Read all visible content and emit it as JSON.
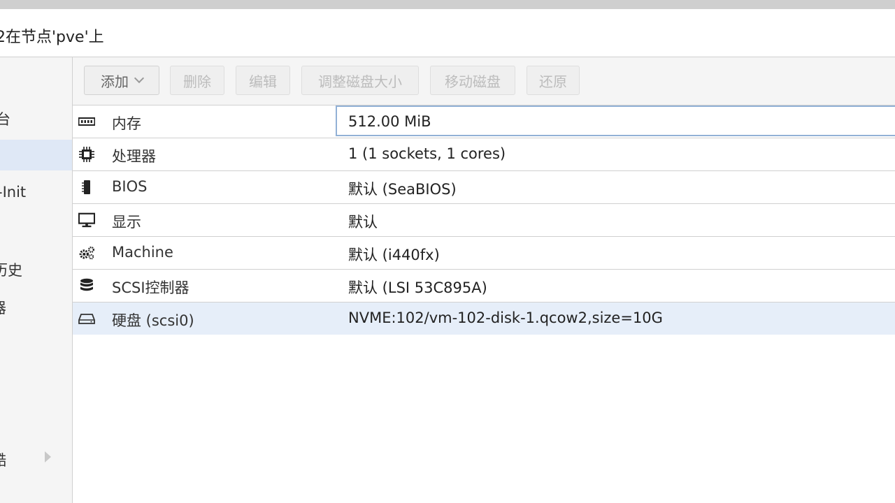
{
  "window": {
    "title": "2在节点'pve'上"
  },
  "sidebar": {
    "items": [
      {
        "label": "台"
      },
      {
        "label": ""
      },
      {
        "label": "-Init"
      },
      {
        "label": "历史"
      },
      {
        "label": "器"
      },
      {
        "label": "酷"
      }
    ]
  },
  "toolbar": {
    "add_label": "添加",
    "delete_label": "删除",
    "edit_label": "编辑",
    "resize_label": "调整磁盘大小",
    "move_label": "移动磁盘",
    "revert_label": "还原"
  },
  "hardware": {
    "rows": [
      {
        "icon": "memory-icon",
        "key": "内存",
        "value": "512.00 MiB"
      },
      {
        "icon": "cpu-icon",
        "key": "处理器",
        "value": "1 (1 sockets, 1 cores)"
      },
      {
        "icon": "bios-chip-icon",
        "key": "BIOS",
        "value": "默认 (SeaBIOS)"
      },
      {
        "icon": "monitor-icon",
        "key": "显示",
        "value": "默认"
      },
      {
        "icon": "gears-icon",
        "key": "Machine",
        "value": "默认 (i440fx)"
      },
      {
        "icon": "database-icon",
        "key": "SCSI控制器",
        "value": "默认 (LSI 53C895A)"
      },
      {
        "icon": "hard-disk-icon",
        "key": "硬盘 (scsi0)",
        "value": "NVME:102/vm-102-disk-1.qcow2,size=10G"
      }
    ]
  },
  "colors": {
    "selection": "#dfe8f6",
    "row_highlight": "#e6eef9",
    "focus_border": "#92b1d6",
    "disabled_text": "#bcbcbc"
  }
}
